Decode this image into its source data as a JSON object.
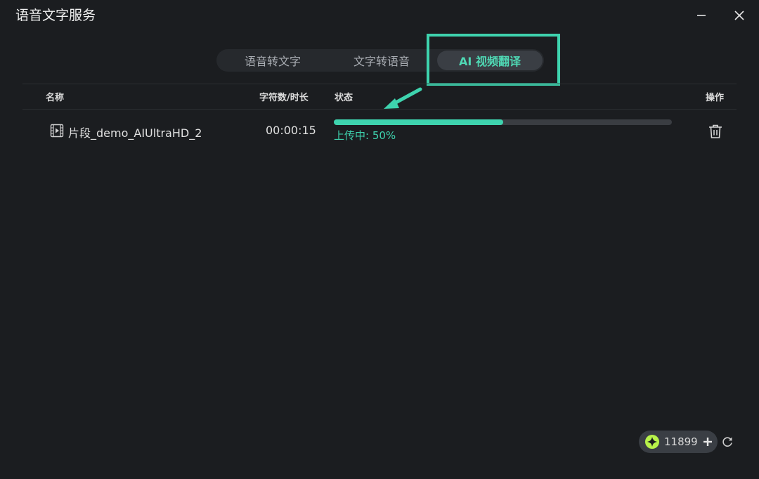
{
  "window": {
    "title": "语音文字服务",
    "minimize_icon": "minimize-icon",
    "close_icon": "close-icon"
  },
  "tabs": [
    {
      "label": "语音转文字",
      "active": false
    },
    {
      "label": "文字转语音",
      "active": false
    },
    {
      "label": "AI 视频翻译",
      "active": true
    }
  ],
  "table": {
    "headers": {
      "name": "名称",
      "length": "字符数/时长",
      "status": "状态",
      "actions": "操作"
    },
    "rows": [
      {
        "icon": "film-icon",
        "name": "片段_demo_AIUltraHD_2",
        "duration": "00:00:15",
        "progress": 0.5,
        "status_text": "上传中: 50%",
        "action_icon": "trash-icon"
      }
    ]
  },
  "footer": {
    "credits_icon": "sparkle-coin-icon",
    "credits": "11899",
    "add_icon": "plus-icon",
    "refresh_icon": "refresh-icon"
  },
  "colors": {
    "accent": "#3ed3ae",
    "background": "#1b1d20",
    "annotation": "#3ed3ae"
  }
}
